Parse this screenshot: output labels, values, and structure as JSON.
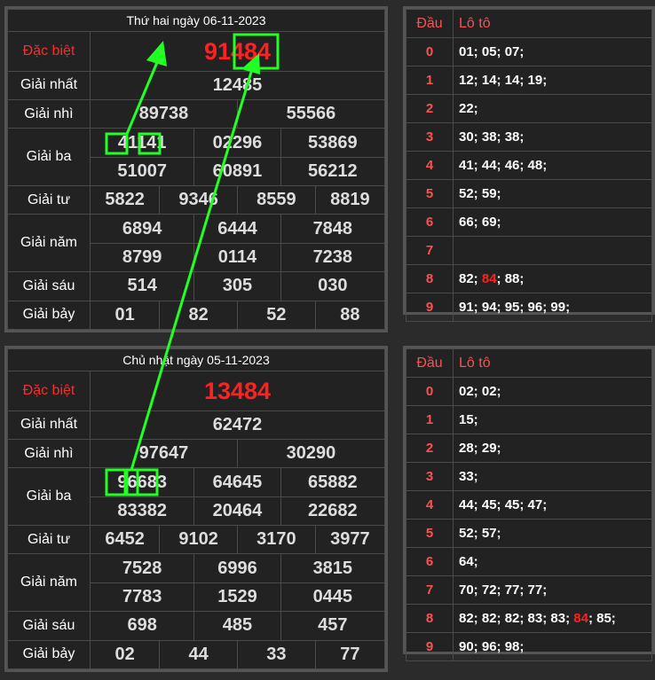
{
  "top": {
    "date_title": "Thứ hai ngày 06-11-2023",
    "labels": {
      "db": "Đặc biệt",
      "g1": "Giải nhất",
      "g2": "Giải nhì",
      "g3": "Giải ba",
      "g4": "Giải tư",
      "g5": "Giải năm",
      "g6": "Giải sáu",
      "g7": "Giải bảy"
    },
    "db": "91484",
    "g1": "12485",
    "g2": [
      "89738",
      "55566"
    ],
    "g3": [
      "41141",
      "02296",
      "53869",
      "51007",
      "60891",
      "56212"
    ],
    "g4": [
      "5822",
      "9346",
      "8559",
      "8819"
    ],
    "g5": [
      "6894",
      "6444",
      "7848",
      "8799",
      "0114",
      "7238"
    ],
    "g6": [
      "514",
      "305",
      "030"
    ],
    "g7": [
      "01",
      "82",
      "52",
      "88"
    ]
  },
  "top_loto": {
    "head_label": "Đầu",
    "loto_label": "Lô tô",
    "rows": [
      {
        "d": "0",
        "v": "01; 05; 07;"
      },
      {
        "d": "1",
        "v": "12; 14; 14; 19;"
      },
      {
        "d": "2",
        "v": "22;"
      },
      {
        "d": "3",
        "v": "30; 38; 38;"
      },
      {
        "d": "4",
        "v": "41; 44; 46; 48;"
      },
      {
        "d": "5",
        "v": "52; 59;"
      },
      {
        "d": "6",
        "v": "66; 69;"
      },
      {
        "d": "7",
        "v": ""
      },
      {
        "d": "8",
        "pre": "82;",
        "hl": "84",
        "post": "; 88;"
      },
      {
        "d": "9",
        "v": "91; 94; 95; 96; 99;"
      }
    ]
  },
  "bottom": {
    "date_title": "Chủ nhật ngày 05-11-2023",
    "labels": {
      "db": "Đặc biệt",
      "g1": "Giải nhất",
      "g2": "Giải nhì",
      "g3": "Giải ba",
      "g4": "Giải tư",
      "g5": "Giải năm",
      "g6": "Giải sáu",
      "g7": "Giải bảy"
    },
    "db": "13484",
    "g1": "62472",
    "g2": [
      "97647",
      "30290"
    ],
    "g3": [
      "96683",
      "64645",
      "65882",
      "83382",
      "20464",
      "22682"
    ],
    "g4": [
      "6452",
      "9102",
      "3170",
      "3977"
    ],
    "g5": [
      "7528",
      "6996",
      "3815",
      "7783",
      "1529",
      "0445"
    ],
    "g6": [
      "698",
      "485",
      "457"
    ],
    "g7": [
      "02",
      "44",
      "33",
      "77"
    ]
  },
  "bottom_loto": {
    "head_label": "Đầu",
    "loto_label": "Lô tô",
    "rows": [
      {
        "d": "0",
        "v": "02; 02;"
      },
      {
        "d": "1",
        "v": "15;"
      },
      {
        "d": "2",
        "v": "28; 29;"
      },
      {
        "d": "3",
        "v": "33;"
      },
      {
        "d": "4",
        "v": "44; 45; 45; 47;"
      },
      {
        "d": "5",
        "v": "52; 57;"
      },
      {
        "d": "6",
        "v": "64;"
      },
      {
        "d": "7",
        "v": "70; 72; 77; 77;"
      },
      {
        "d": "8",
        "pre": "82; 82; 82; 83; 83;",
        "hl": "84",
        "post": "; 85;"
      },
      {
        "d": "9",
        "v": "90; 96; 98;"
      }
    ]
  },
  "colors": {
    "arrow": "#22ff22",
    "highlight": "#ff2020",
    "label_red": "#ff2a2a"
  }
}
